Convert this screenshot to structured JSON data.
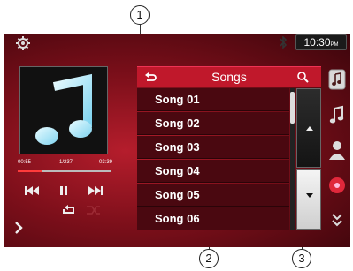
{
  "callouts": [
    "1",
    "2",
    "3"
  ],
  "status_bar": {
    "clock": "10:30",
    "clock_suffix": "PM",
    "settings_icon": "gear-icon",
    "bluetooth_icon": "bluetooth-icon"
  },
  "now_playing": {
    "elapsed": "00:55",
    "track_position": "1/237",
    "duration": "03:39",
    "progress": 0.25
  },
  "controls": {
    "previous_icon": "previous-track-icon",
    "play_pause_icon": "pause-icon",
    "next_icon": "next-track-icon",
    "repeat_icon": "repeat-icon",
    "shuffle_icon": "shuffle-icon",
    "expand_icon": "chevron-right-icon"
  },
  "list": {
    "title": "Songs",
    "items": [
      "Song 01",
      "Song 02",
      "Song 03",
      "Song 04",
      "Song 05",
      "Song 06"
    ]
  },
  "side_tabs": [
    "music-library-icon",
    "music-note-icon",
    "artist-icon",
    "album-disc-icon",
    "more-icon"
  ],
  "colors": {
    "accent_red": "#c0182b",
    "panel_dark": "#4a0810"
  }
}
